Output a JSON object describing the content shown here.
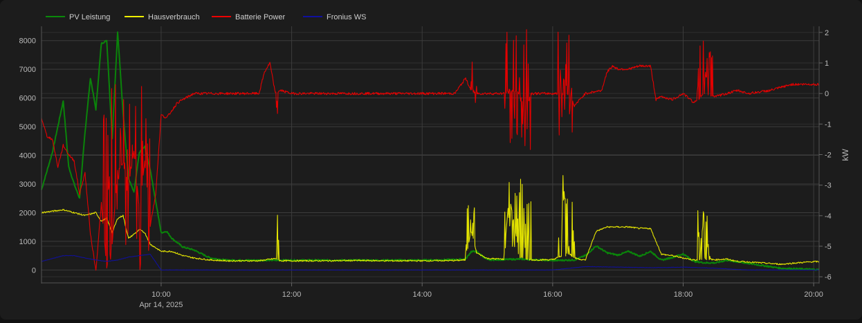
{
  "chart_data": {
    "type": "line",
    "x_unit": "time",
    "x_ticks": [
      "10:00",
      "12:00",
      "14:00",
      "16:00",
      "18:00",
      "20:00"
    ],
    "x_date_label": "Apr 14, 2025",
    "xlim": [
      "08:10",
      "20:05"
    ],
    "y_left": {
      "ticks": [
        0,
        1000,
        2000,
        3000,
        4000,
        5000,
        6000,
        7000,
        8000
      ],
      "ylim": [
        -450,
        8500
      ],
      "label": ""
    },
    "y_right": {
      "ticks": [
        2,
        1,
        0,
        -1,
        -2,
        -3,
        -4,
        -5,
        -6
      ],
      "ylim": [
        -6.2,
        2.2
      ],
      "label": "kW"
    },
    "grid": true,
    "legend_placement": "top-left",
    "series": [
      {
        "name": "PV Leistung",
        "color": "#0a8a0a",
        "axis": "left",
        "x": [
          "08:10",
          "08:20",
          "08:30",
          "08:35",
          "08:40",
          "08:45",
          "08:50",
          "08:55",
          "09:00",
          "09:05",
          "09:10",
          "09:15",
          "09:20",
          "09:25",
          "09:30",
          "09:35",
          "09:40",
          "09:45",
          "09:50",
          "10:00",
          "10:05",
          "10:10",
          "10:20",
          "10:30",
          "10:45",
          "11:00",
          "11:30",
          "12:00",
          "12:30",
          "13:00",
          "13:30",
          "14:00",
          "14:30",
          "14:40",
          "14:45",
          "14:50",
          "15:00",
          "15:30",
          "16:00",
          "16:20",
          "16:30",
          "16:40",
          "16:50",
          "17:00",
          "17:10",
          "17:20",
          "17:30",
          "17:40",
          "17:50",
          "18:00",
          "18:10",
          "18:20",
          "18:30",
          "18:40",
          "18:50",
          "19:00",
          "19:30",
          "20:00",
          "20:05"
        ],
        "y": [
          2800,
          4100,
          5900,
          3600,
          3000,
          2500,
          4800,
          6700,
          5600,
          7900,
          8000,
          4600,
          8300,
          5500,
          3200,
          2700,
          4100,
          4300,
          3500,
          1300,
          1350,
          1100,
          800,
          700,
          420,
          340,
          340,
          340,
          340,
          340,
          340,
          340,
          360,
          380,
          640,
          650,
          350,
          380,
          330,
          350,
          500,
          840,
          600,
          520,
          650,
          480,
          650,
          340,
          440,
          560,
          300,
          250,
          250,
          340,
          280,
          230,
          60,
          20,
          10
        ]
      },
      {
        "name": "Hausverbrauch",
        "color": "#f0f000",
        "axis": "left",
        "x": [
          "08:10",
          "08:20",
          "08:30",
          "08:40",
          "08:50",
          "09:00",
          "09:05",
          "09:10",
          "09:15",
          "09:20",
          "09:25",
          "09:30",
          "09:40",
          "09:45",
          "09:50",
          "10:00",
          "10:10",
          "10:20",
          "10:30",
          "10:45",
          "11:00",
          "11:30",
          "11:45",
          "11:50",
          "12:00",
          "12:30",
          "13:00",
          "13:30",
          "14:00",
          "14:30",
          "14:40",
          "14:45",
          "14:50",
          "15:00",
          "15:15",
          "15:20",
          "15:30",
          "15:40",
          "16:00",
          "16:15",
          "16:20",
          "16:30",
          "16:40",
          "16:50",
          "17:00",
          "17:10",
          "17:20",
          "17:30",
          "17:40",
          "17:50",
          "18:00",
          "18:10",
          "18:20",
          "18:30",
          "18:40",
          "18:50",
          "19:00",
          "19:30",
          "19:45",
          "20:00",
          "20:05"
        ],
        "y": [
          2000,
          2050,
          2100,
          2000,
          1900,
          2000,
          1700,
          1800,
          1300,
          1800,
          1900,
          1100,
          1400,
          1300,
          900,
          650,
          650,
          500,
          420,
          350,
          320,
          320,
          400,
          320,
          320,
          320,
          330,
          320,
          320,
          330,
          350,
          1400,
          600,
          400,
          380,
          2600,
          450,
          350,
          360,
          600,
          420,
          340,
          1350,
          1500,
          1500,
          1500,
          1450,
          1450,
          550,
          500,
          420,
          350,
          380,
          360,
          380,
          300,
          280,
          200,
          250,
          290,
          290
        ]
      },
      {
        "name": "Batterie Power",
        "color": "#ee0000",
        "axis": "right",
        "x": [
          "08:10",
          "08:15",
          "08:20",
          "08:25",
          "08:30",
          "08:35",
          "08:40",
          "08:45",
          "08:50",
          "08:55",
          "09:00",
          "09:05",
          "09:10",
          "09:15",
          "09:20",
          "09:25",
          "09:30",
          "09:35",
          "09:40",
          "09:45",
          "09:50",
          "09:55",
          "10:00",
          "10:05",
          "10:15",
          "10:30",
          "11:00",
          "11:30",
          "11:35",
          "11:40",
          "11:45",
          "11:50",
          "12:00",
          "12:30",
          "13:00",
          "13:30",
          "14:00",
          "14:20",
          "14:30",
          "14:40",
          "14:45",
          "14:50",
          "15:00",
          "15:15",
          "15:20",
          "15:30",
          "15:35",
          "15:40",
          "16:00",
          "16:15",
          "16:20",
          "16:30",
          "16:45",
          "16:50",
          "16:55",
          "17:00",
          "17:10",
          "17:20",
          "17:30",
          "17:35",
          "17:40",
          "17:50",
          "18:00",
          "18:10",
          "18:20",
          "18:30",
          "18:40",
          "18:50",
          "19:00",
          "19:20",
          "19:40",
          "20:00",
          "20:05"
        ],
        "y": [
          -0.8,
          -1.4,
          -1.5,
          -2.4,
          -1.7,
          -2.0,
          -2.2,
          -3.3,
          -2.6,
          -4.6,
          -5.8,
          -3.6,
          -5.7,
          -4.9,
          -2.5,
          -2.3,
          -3.0,
          -1.9,
          -3.8,
          -2.2,
          -4.3,
          -3.3,
          -0.7,
          -0.8,
          -0.3,
          0.0,
          0.0,
          0.0,
          0.7,
          1.0,
          0.0,
          0.1,
          0.0,
          0.0,
          0.0,
          0.0,
          0.0,
          0.0,
          0.0,
          0.5,
          0.1,
          0.0,
          0.0,
          0.0,
          0.1,
          0.0,
          -0.6,
          0.0,
          0.0,
          0.0,
          -0.4,
          0.0,
          0.1,
          0.7,
          0.9,
          0.8,
          0.8,
          0.9,
          0.9,
          -0.2,
          -0.1,
          -0.2,
          0.0,
          -0.3,
          0.0,
          -0.1,
          0.0,
          0.1,
          0.0,
          0.1,
          0.3,
          0.3,
          0.3
        ]
      },
      {
        "name": "Fronius WS",
        "color": "#1010a0",
        "axis": "left",
        "x": [
          "08:10",
          "08:20",
          "08:30",
          "08:40",
          "08:50",
          "09:00",
          "09:10",
          "09:20",
          "09:30",
          "09:40",
          "09:50",
          "10:00",
          "10:10",
          "10:30",
          "11:00",
          "12:00",
          "13:00",
          "14:00",
          "14:30",
          "14:40",
          "15:00",
          "15:30",
          "16:00",
          "16:30",
          "17:00",
          "17:30",
          "18:00",
          "18:30",
          "19:00",
          "19:30",
          "20:05"
        ],
        "y": [
          300,
          400,
          500,
          500,
          420,
          350,
          300,
          350,
          450,
          500,
          550,
          0,
          0,
          0,
          0,
          0,
          0,
          0,
          0,
          0,
          0,
          0,
          0,
          120,
          100,
          80,
          100,
          60,
          0,
          0,
          0
        ]
      }
    ],
    "spike_windows_battery": [
      {
        "from": "09:05",
        "to": "09:50",
        "min": -5.9,
        "max": 0.7
      },
      {
        "from": "11:45",
        "to": "11:47",
        "min": -1.1,
        "max": 0.2
      },
      {
        "from": "14:45",
        "to": "14:50",
        "min": -1.3,
        "max": 1.2
      },
      {
        "from": "15:15",
        "to": "15:40",
        "min": -1.9,
        "max": 2.1
      },
      {
        "from": "16:05",
        "to": "16:20",
        "min": -1.4,
        "max": 2.2
      },
      {
        "from": "18:13",
        "to": "18:27",
        "min": 0.0,
        "max": 1.9
      }
    ],
    "spike_windows_house": [
      {
        "from": "11:46",
        "to": "11:48",
        "min": 300,
        "max": 2000
      },
      {
        "from": "14:40",
        "to": "14:48",
        "min": 350,
        "max": 2350
      },
      {
        "from": "15:15",
        "to": "15:40",
        "min": 350,
        "max": 3200
      },
      {
        "from": "16:05",
        "to": "16:20",
        "min": 350,
        "max": 3300
      },
      {
        "from": "18:13",
        "to": "18:27",
        "min": 350,
        "max": 2200
      }
    ]
  }
}
